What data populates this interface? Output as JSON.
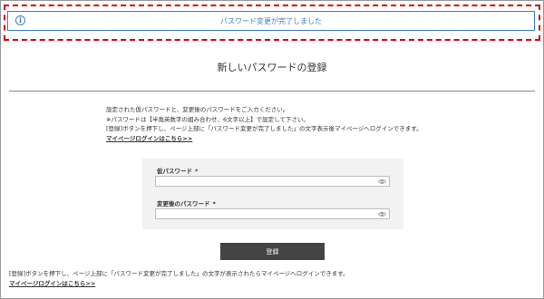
{
  "banner": {
    "message": "パスワード変更が完了しました",
    "icon": "info-icon",
    "accent_color": "#3f7fbf",
    "highlight_color": "#d40000"
  },
  "page": {
    "title": "新しいパスワードの登録"
  },
  "instructions": {
    "line1": "設定された仮パスワードと、変更後のパスワードをご入力ください。",
    "line2": "※パスワードは【半角英数字の組み合わせ、6文字以上】で設定して下さい。",
    "line3": "[登録]ボタンを押下し、ページ上部に「パスワード変更が完了しました」の文字表示後マイページへログインできます。",
    "login_link": "マイページログインはこちら>>"
  },
  "form": {
    "temp_password": {
      "label": "仮パスワード",
      "required_mark": "*",
      "value": "",
      "icon": "eye-icon"
    },
    "new_password": {
      "label": "変更後のパスワード",
      "required_mark": "*",
      "value": "",
      "icon": "eye-icon"
    },
    "submit_label": "登録"
  },
  "footer": {
    "note": "[登録]ボタンを押下し、ページ上部に「パスワード変更が完了しました」の文字が表示されたらマイページへログインできます。",
    "login_link": "マイページログインはこちら>>"
  }
}
